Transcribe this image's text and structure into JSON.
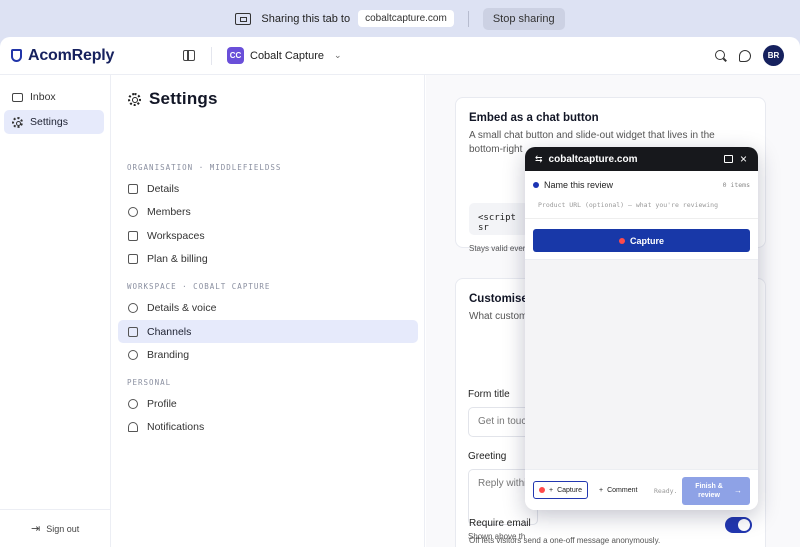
{
  "share_bar": {
    "text": "Sharing this tab to",
    "domain": "cobaltcapture.com",
    "stop_label": "Stop sharing"
  },
  "topbar": {
    "logo": "AcomReply",
    "workspace_initials": "CC",
    "workspace_name": "Cobalt Capture",
    "avatar_initials": "BR",
    "icons": [
      "sidebar-toggle-icon",
      "chevron-down-icon",
      "search-icon",
      "chat-icon"
    ]
  },
  "leftnav": {
    "items": [
      {
        "label": "Inbox",
        "icon": "inbox-icon"
      },
      {
        "label": "Settings",
        "icon": "gear-icon",
        "active": true
      }
    ],
    "signout": "Sign out"
  },
  "settings": {
    "title": "Settings",
    "sections": [
      {
        "label": "ORGANISATION · MIDDLEFIELDSS",
        "items": [
          {
            "label": "Details",
            "icon": "document-icon"
          },
          {
            "label": "Members",
            "icon": "users-icon"
          },
          {
            "label": "Workspaces",
            "icon": "layers-icon"
          },
          {
            "label": "Plan & billing",
            "icon": "credit-card-icon"
          }
        ]
      },
      {
        "label": "WORKSPACE · COBALT CAPTURE",
        "items": [
          {
            "label": "Details & voice",
            "icon": "gear-icon"
          },
          {
            "label": "Channels",
            "icon": "external-link-icon",
            "active": true
          },
          {
            "label": "Branding",
            "icon": "palette-icon"
          }
        ]
      },
      {
        "label": "PERSONAL",
        "items": [
          {
            "label": "Profile",
            "icon": "user-icon"
          },
          {
            "label": "Notifications",
            "icon": "bell-icon"
          }
        ]
      }
    ]
  },
  "main": {
    "embed": {
      "title": "Embed as a chat button",
      "desc": "A small chat button and slide-out widget that lives in the bottom-right",
      "code": "<script sr",
      "note": "Stays valid ever"
    },
    "customise": {
      "title": "Customise",
      "desc": "What custom",
      "form_title_label": "Form title",
      "form_title_value": "Get in touc",
      "greeting_label": "Greeting",
      "greeting_value": "Reply within",
      "shown_note": "Shown above th",
      "require_email_label": "Require email",
      "require_email_note": "Off lets visitors send a one-off message anonymously.",
      "require_email_on": true
    }
  },
  "widget": {
    "domain": "cobaltcapture.com",
    "review_name": "Name this review",
    "items_count": "0 items",
    "url_placeholder": "Product URL (optional) — what you're reviewing",
    "capture_label": "Capture",
    "foot": {
      "capture_label": "Capture",
      "comment_label": "Comment",
      "status": "Ready.",
      "finish_label": "Finish & review"
    }
  }
}
